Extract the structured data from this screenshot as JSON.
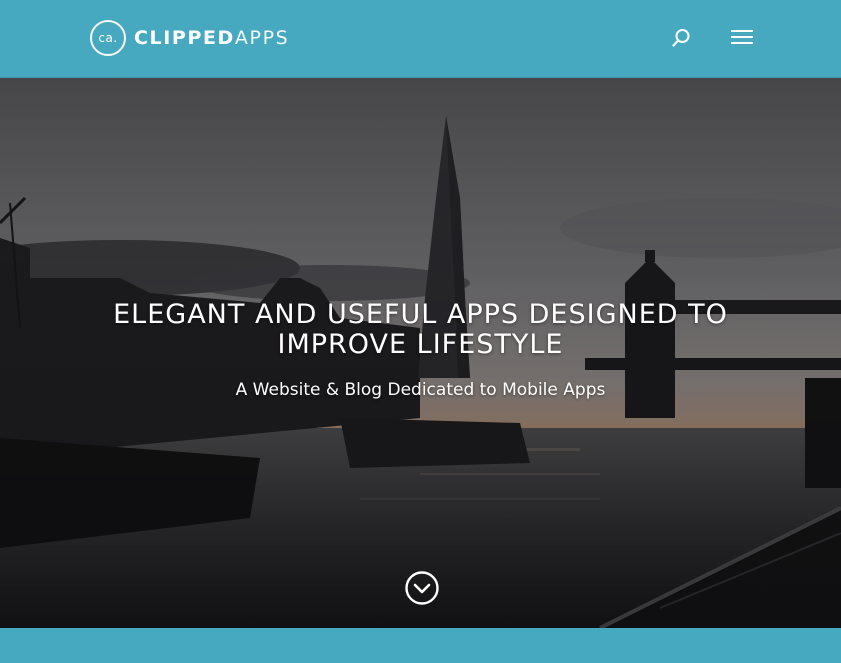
{
  "header": {
    "logo": {
      "mark": "ca.",
      "word_bold": "CLIPPED",
      "word_light": "APPS"
    },
    "search_icon": "search-icon",
    "menu_icon": "hamburger-menu-icon"
  },
  "hero": {
    "image": "london-skyline-shard-tower-bridge-dusk",
    "title_line1": "ELEGANT AND USEFUL APPS DESIGNED TO",
    "title_line2": "IMPROVE LIFESTYLE",
    "subtitle": "A Website & Blog Dedicated to Mobile Apps",
    "scroll_icon": "chevron-down-circle-icon"
  },
  "colors": {
    "accent": "#46a9c0",
    "text": "#ffffff"
  }
}
